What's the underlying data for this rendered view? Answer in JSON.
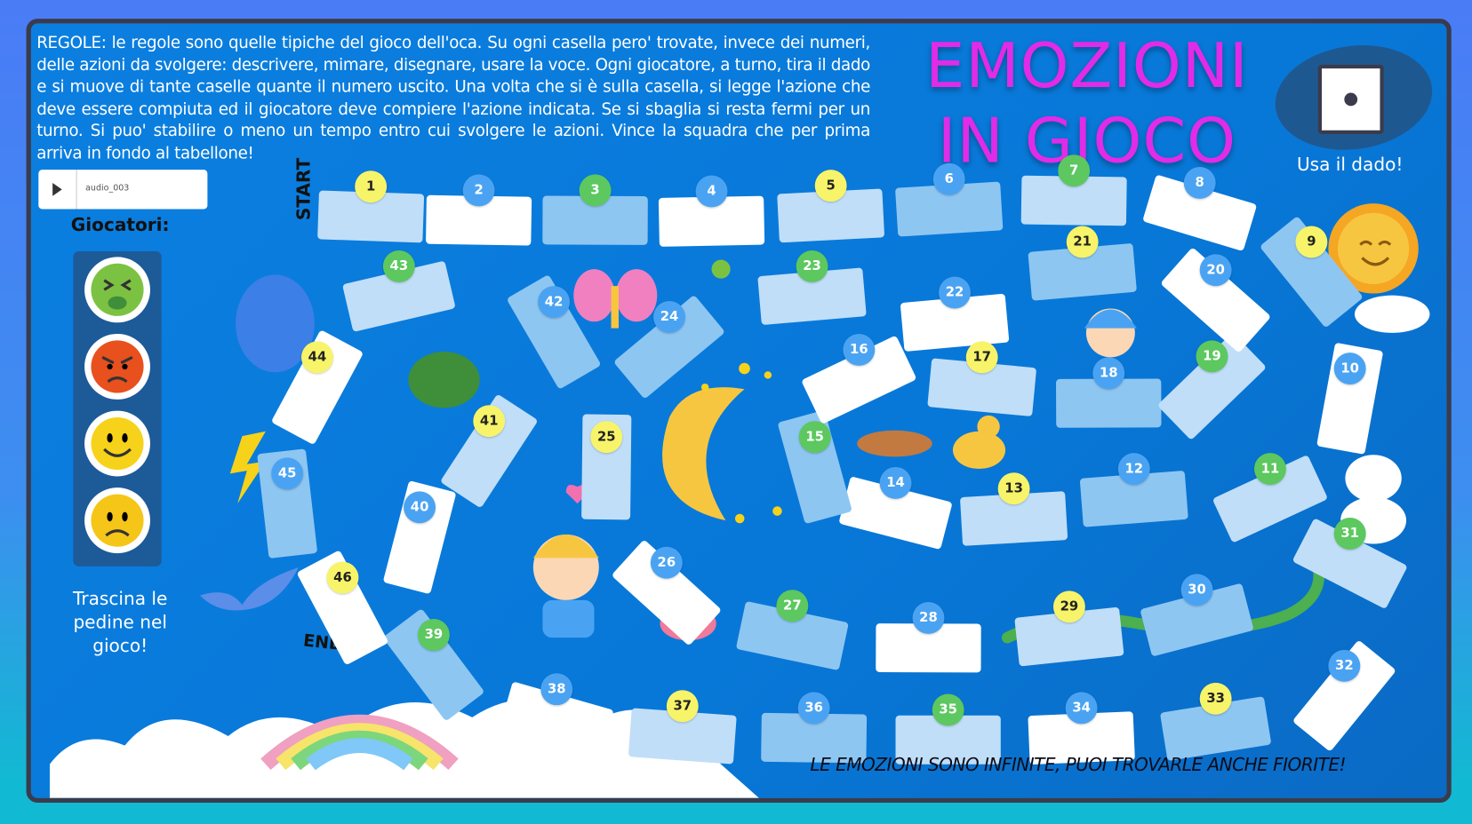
{
  "rules": "REGOLE: le regole sono quelle tipiche del gioco dell'oca. Su ogni casella pero' trovate, invece dei numeri, delle azioni da svolgere: descrivere, mimare, disegnare, usare la voce. Ogni giocatore, a turno, tira il dado e si muove di tante caselle quante il numero uscito. Una volta che si è sulla casella, si legge l'azione che deve essere compiuta ed il giocatore deve compiere l'azione indicata. Se si sbaglia si resta fermi per un turno. Si puo' stabilire o meno un tempo entro cui svolgere le azioni. Vince la squadra che per prima arriva in fondo al tabellone!",
  "title_line1": "EMOZIONI",
  "title_line2": "IN GIOCO",
  "dice": {
    "label": "Usa il dado!",
    "value": 1
  },
  "audio": {
    "name": "audio_003",
    "play_icon": "play-icon"
  },
  "players": {
    "label": "Giocatori:",
    "pawns": [
      {
        "icon": "nauseated-face-icon",
        "color": "#7cc242"
      },
      {
        "icon": "angry-face-icon",
        "color": "#e8501e"
      },
      {
        "icon": "smiling-face-icon",
        "color": "#f7d21a"
      },
      {
        "icon": "frowning-face-icon",
        "color": "#f5c518"
      }
    ],
    "hint": "Trascina le pedine nel gioco!"
  },
  "board": {
    "start_label": "START",
    "end_label": "END",
    "squares": [
      "1",
      "2",
      "3",
      "4",
      "5",
      "6",
      "7",
      "8",
      "9",
      "10",
      "11",
      "12",
      "13",
      "14",
      "15",
      "16",
      "17",
      "18",
      "19",
      "20",
      "21",
      "22",
      "23",
      "24",
      "25",
      "26",
      "27",
      "28",
      "29",
      "30",
      "31",
      "32",
      "33",
      "34",
      "35",
      "36",
      "37",
      "38",
      "39",
      "40",
      "41",
      "42",
      "43",
      "44",
      "45",
      "46"
    ],
    "colors": {
      "yellow": "#f7f46a",
      "blue": "#4aa3f2",
      "green": "#5cc85f"
    }
  },
  "slogan": "LE EMOZIONI SONO INFINITE, PUOI TROVARLE ANCHE FIORITE!"
}
